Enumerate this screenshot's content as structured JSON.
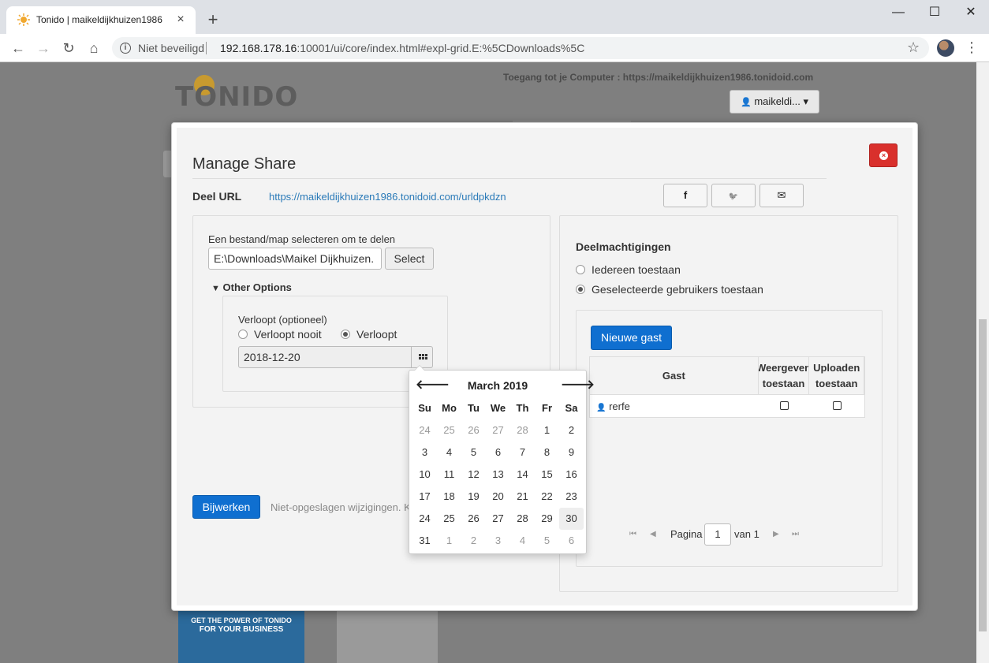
{
  "browser": {
    "tab_title": "Tonido | maikeldijkhuizen1986",
    "tab_close": "×",
    "new_tab": "+",
    "security_label": "Niet beveiligd",
    "url_host": "192.168.178.16",
    "url_rest": ":10001/ui/core/index.html#expl-grid.E:%5CDownloads%5C",
    "window_controls": {
      "minimize": "—",
      "maximize": "☐",
      "close": "✕"
    },
    "nav": {
      "back": "←",
      "forward": "→",
      "reload": "↻",
      "home": "⌂",
      "star": "☆",
      "menu": "⋮"
    }
  },
  "page": {
    "logo": "TONIDO",
    "access_text": "Toegang tot je Computer : https://maikeldijkhuizen1986.tonidoid.com",
    "user_button": "maikeldi... ▾",
    "banner_line1": "GET THE POWER OF TONIDO",
    "banner_line2": "FOR YOUR BUSINESS"
  },
  "modal": {
    "title": "Manage Share",
    "share_label": "Deel URL",
    "share_url": "https://maikeldijkhuizen1986.tonidoid.com/urldpkdzn",
    "social": {
      "facebook": "f",
      "twitter": "🐦",
      "email": "✉"
    },
    "left": {
      "select_label": "Een bestand/map selecteren om te delen",
      "path_value": "E:\\Downloads\\Maikel Dijkhuizen.",
      "select_button": "Select",
      "other_options": "Other Options",
      "expires_label": "Verloopt (optioneel)",
      "never_expires": "Verloopt nooit",
      "expires": "Verloopt",
      "expires_selected": "expires",
      "date_value": "2018-12-20",
      "update_button": "Bijwerken",
      "unsaved_text": "Niet-opgeslagen wijzigingen. K"
    },
    "right": {
      "permissions_title": "Deelmachtigingen",
      "allow_everyone": "Iedereen toestaan",
      "allow_selected": "Geselecteerde gebruikers toestaan",
      "permission_selected": "selected",
      "new_guest_button": "Nieuwe gast",
      "columns": [
        "Gast",
        "Weergeven toestaan",
        "Uploaden toestaan"
      ],
      "rows": [
        {
          "guest": "rerfe",
          "view": false,
          "upload": false
        }
      ],
      "pager": {
        "label": "Pagina",
        "page": "1",
        "of": "van 1"
      }
    }
  },
  "datepicker": {
    "month": "March 2019",
    "prev": "🡐",
    "next": "🡒",
    "weekdays": [
      "Su",
      "Mo",
      "Tu",
      "We",
      "Th",
      "Fr",
      "Sa"
    ],
    "weeks": [
      [
        "24",
        "25",
        "26",
        "27",
        "28",
        "1",
        "2"
      ],
      [
        "3",
        "4",
        "5",
        "6",
        "7",
        "8",
        "9"
      ],
      [
        "10",
        "11",
        "12",
        "13",
        "14",
        "15",
        "16"
      ],
      [
        "17",
        "18",
        "19",
        "20",
        "21",
        "22",
        "23"
      ],
      [
        "24",
        "25",
        "26",
        "27",
        "28",
        "29",
        "30"
      ],
      [
        "31",
        "1",
        "2",
        "3",
        "4",
        "5",
        "6"
      ]
    ],
    "muted": [
      [
        0,
        0
      ],
      [
        0,
        1
      ],
      [
        0,
        2
      ],
      [
        0,
        3
      ],
      [
        0,
        4
      ],
      [
        5,
        1
      ],
      [
        5,
        2
      ],
      [
        5,
        3
      ],
      [
        5,
        4
      ],
      [
        5,
        5
      ],
      [
        5,
        6
      ]
    ],
    "today": [
      4,
      6
    ]
  }
}
